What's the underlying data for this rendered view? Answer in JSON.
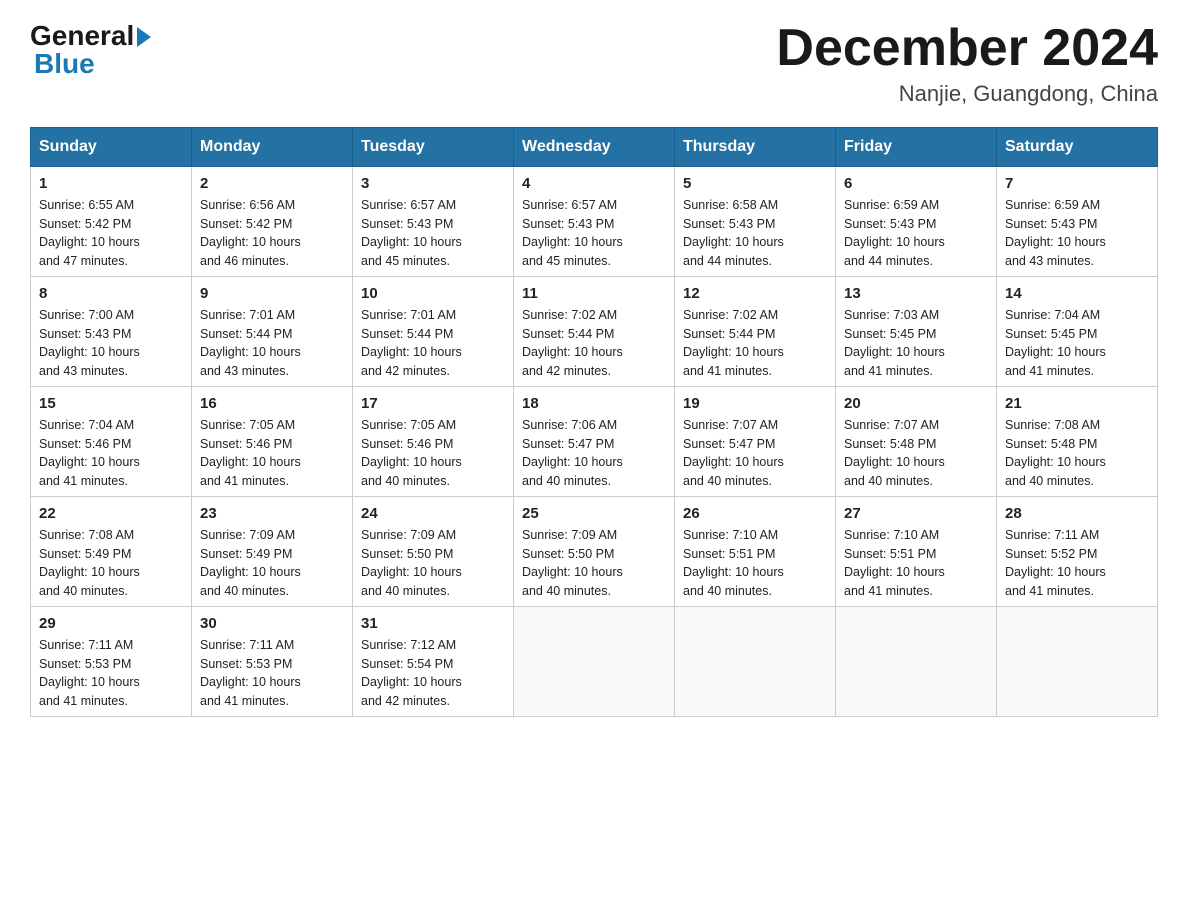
{
  "logo": {
    "general": "General",
    "arrow": "",
    "blue": "Blue"
  },
  "title": "December 2024",
  "location": "Nanjie, Guangdong, China",
  "days_header": [
    "Sunday",
    "Monday",
    "Tuesday",
    "Wednesday",
    "Thursday",
    "Friday",
    "Saturday"
  ],
  "weeks": [
    [
      {
        "num": "1",
        "sunrise": "6:55 AM",
        "sunset": "5:42 PM",
        "daylight": "10 hours and 47 minutes."
      },
      {
        "num": "2",
        "sunrise": "6:56 AM",
        "sunset": "5:42 PM",
        "daylight": "10 hours and 46 minutes."
      },
      {
        "num": "3",
        "sunrise": "6:57 AM",
        "sunset": "5:43 PM",
        "daylight": "10 hours and 45 minutes."
      },
      {
        "num": "4",
        "sunrise": "6:57 AM",
        "sunset": "5:43 PM",
        "daylight": "10 hours and 45 minutes."
      },
      {
        "num": "5",
        "sunrise": "6:58 AM",
        "sunset": "5:43 PM",
        "daylight": "10 hours and 44 minutes."
      },
      {
        "num": "6",
        "sunrise": "6:59 AM",
        "sunset": "5:43 PM",
        "daylight": "10 hours and 44 minutes."
      },
      {
        "num": "7",
        "sunrise": "6:59 AM",
        "sunset": "5:43 PM",
        "daylight": "10 hours and 43 minutes."
      }
    ],
    [
      {
        "num": "8",
        "sunrise": "7:00 AM",
        "sunset": "5:43 PM",
        "daylight": "10 hours and 43 minutes."
      },
      {
        "num": "9",
        "sunrise": "7:01 AM",
        "sunset": "5:44 PM",
        "daylight": "10 hours and 43 minutes."
      },
      {
        "num": "10",
        "sunrise": "7:01 AM",
        "sunset": "5:44 PM",
        "daylight": "10 hours and 42 minutes."
      },
      {
        "num": "11",
        "sunrise": "7:02 AM",
        "sunset": "5:44 PM",
        "daylight": "10 hours and 42 minutes."
      },
      {
        "num": "12",
        "sunrise": "7:02 AM",
        "sunset": "5:44 PM",
        "daylight": "10 hours and 41 minutes."
      },
      {
        "num": "13",
        "sunrise": "7:03 AM",
        "sunset": "5:45 PM",
        "daylight": "10 hours and 41 minutes."
      },
      {
        "num": "14",
        "sunrise": "7:04 AM",
        "sunset": "5:45 PM",
        "daylight": "10 hours and 41 minutes."
      }
    ],
    [
      {
        "num": "15",
        "sunrise": "7:04 AM",
        "sunset": "5:46 PM",
        "daylight": "10 hours and 41 minutes."
      },
      {
        "num": "16",
        "sunrise": "7:05 AM",
        "sunset": "5:46 PM",
        "daylight": "10 hours and 41 minutes."
      },
      {
        "num": "17",
        "sunrise": "7:05 AM",
        "sunset": "5:46 PM",
        "daylight": "10 hours and 40 minutes."
      },
      {
        "num": "18",
        "sunrise": "7:06 AM",
        "sunset": "5:47 PM",
        "daylight": "10 hours and 40 minutes."
      },
      {
        "num": "19",
        "sunrise": "7:07 AM",
        "sunset": "5:47 PM",
        "daylight": "10 hours and 40 minutes."
      },
      {
        "num": "20",
        "sunrise": "7:07 AM",
        "sunset": "5:48 PM",
        "daylight": "10 hours and 40 minutes."
      },
      {
        "num": "21",
        "sunrise": "7:08 AM",
        "sunset": "5:48 PM",
        "daylight": "10 hours and 40 minutes."
      }
    ],
    [
      {
        "num": "22",
        "sunrise": "7:08 AM",
        "sunset": "5:49 PM",
        "daylight": "10 hours and 40 minutes."
      },
      {
        "num": "23",
        "sunrise": "7:09 AM",
        "sunset": "5:49 PM",
        "daylight": "10 hours and 40 minutes."
      },
      {
        "num": "24",
        "sunrise": "7:09 AM",
        "sunset": "5:50 PM",
        "daylight": "10 hours and 40 minutes."
      },
      {
        "num": "25",
        "sunrise": "7:09 AM",
        "sunset": "5:50 PM",
        "daylight": "10 hours and 40 minutes."
      },
      {
        "num": "26",
        "sunrise": "7:10 AM",
        "sunset": "5:51 PM",
        "daylight": "10 hours and 40 minutes."
      },
      {
        "num": "27",
        "sunrise": "7:10 AM",
        "sunset": "5:51 PM",
        "daylight": "10 hours and 41 minutes."
      },
      {
        "num": "28",
        "sunrise": "7:11 AM",
        "sunset": "5:52 PM",
        "daylight": "10 hours and 41 minutes."
      }
    ],
    [
      {
        "num": "29",
        "sunrise": "7:11 AM",
        "sunset": "5:53 PM",
        "daylight": "10 hours and 41 minutes."
      },
      {
        "num": "30",
        "sunrise": "7:11 AM",
        "sunset": "5:53 PM",
        "daylight": "10 hours and 41 minutes."
      },
      {
        "num": "31",
        "sunrise": "7:12 AM",
        "sunset": "5:54 PM",
        "daylight": "10 hours and 42 minutes."
      },
      null,
      null,
      null,
      null
    ]
  ],
  "labels": {
    "sunrise": "Sunrise:",
    "sunset": "Sunset:",
    "daylight": "Daylight:"
  }
}
